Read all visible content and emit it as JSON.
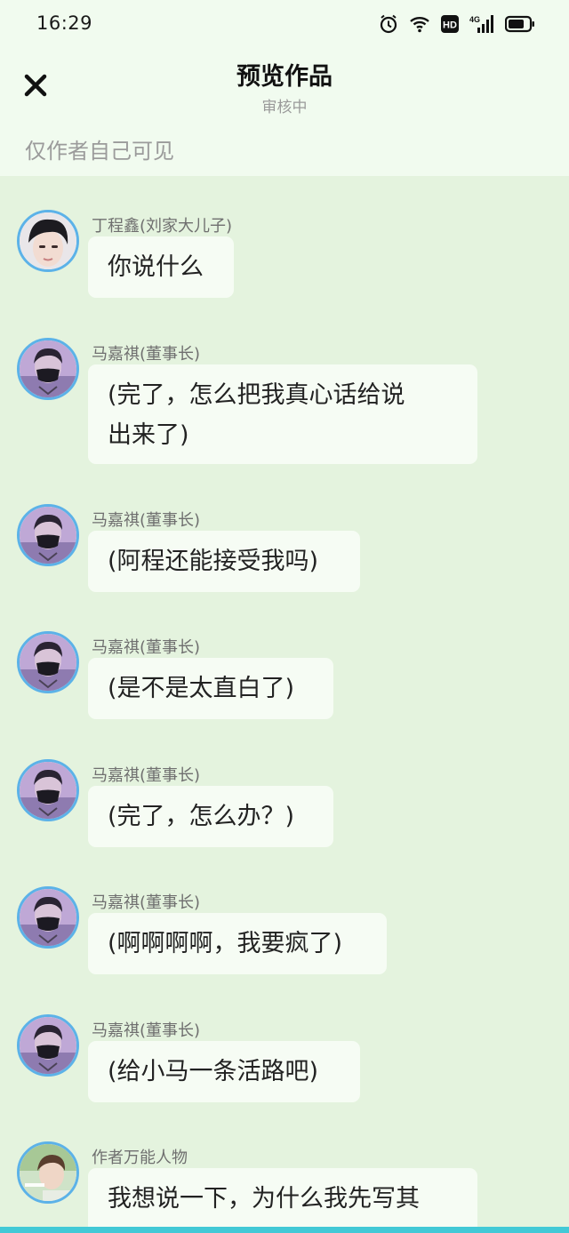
{
  "status_bar": {
    "time": "16:29",
    "icons": [
      "alarm-icon",
      "wifi-icon",
      "hd-icon",
      "signal-4g-icon",
      "battery-icon"
    ],
    "hd_label": "HD",
    "network_label": "4G"
  },
  "header": {
    "title": "预览作品",
    "subtitle": "审核中",
    "notice": "仅作者自己可见",
    "close_icon": "close-icon"
  },
  "messages": [
    {
      "sender": "丁程鑫(刘家大儿子)",
      "text": "你说什么",
      "avatar": "avatar-dingchengxin"
    },
    {
      "sender": "马嘉祺(董事长)",
      "text": "(完了，怎么把我真心话给说\n出来了)",
      "avatar": "avatar-majiaqi"
    },
    {
      "sender": "马嘉祺(董事长)",
      "text": "(阿程还能接受我吗)",
      "avatar": "avatar-majiaqi"
    },
    {
      "sender": "马嘉祺(董事长)",
      "text": "(是不是太直白了)",
      "avatar": "avatar-majiaqi"
    },
    {
      "sender": "马嘉祺(董事长)",
      "text": "(完了，怎么办？)",
      "avatar": "avatar-majiaqi"
    },
    {
      "sender": "马嘉祺(董事长)",
      "text": "(啊啊啊啊，我要疯了)",
      "avatar": "avatar-majiaqi"
    },
    {
      "sender": "马嘉祺(董事长)",
      "text": "(给小马一条活路吧)",
      "avatar": "avatar-majiaqi"
    },
    {
      "sender": "作者万能人物",
      "text": "我想说一下，为什么我先写其",
      "avatar": "avatar-author"
    }
  ],
  "colors": {
    "chat_background": "#e4f3de",
    "header_background": "#f1fbef",
    "bubble_background": "#f6fcf4",
    "avatar_ring": "#5cb2e8",
    "bottom_bar": "#42c9d6"
  }
}
